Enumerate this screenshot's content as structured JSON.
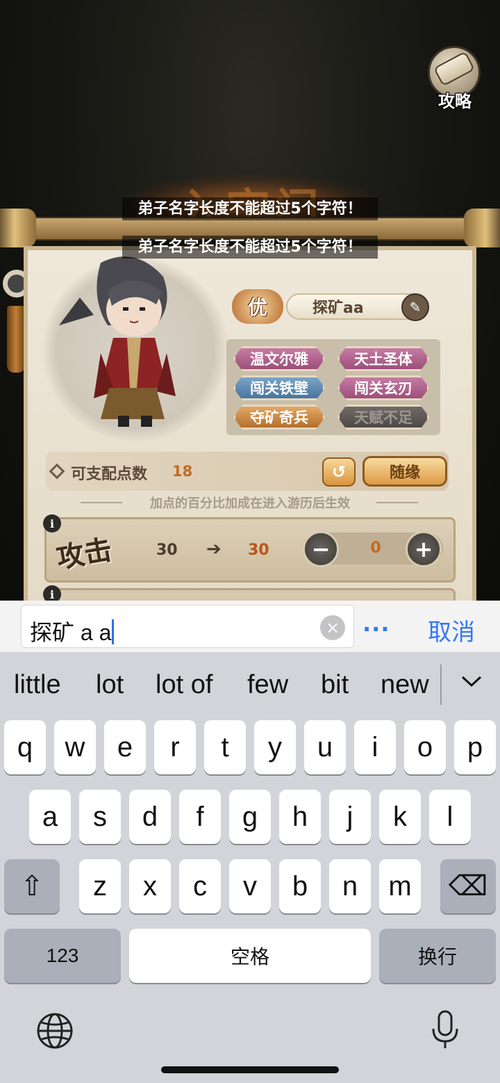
{
  "game": {
    "guide_label": "攻略",
    "title_text": "入宗门",
    "toast_messages": [
      "弟子名字长度不能超过5个字符！",
      "弟子名字长度不能超过5个字符！"
    ],
    "grade": "优",
    "disciple_name": "探矿aa",
    "traits": [
      {
        "label": "温文尔雅",
        "color": "pink"
      },
      {
        "label": "天土圣体",
        "color": "pink"
      },
      {
        "label": "闯关铁壁",
        "color": "blue"
      },
      {
        "label": "闯关玄刃",
        "color": "pink"
      },
      {
        "label": "夺矿奇兵",
        "color": "orange"
      },
      {
        "label": "天赋不足",
        "color": "grey"
      }
    ],
    "points_label": "可支配点数",
    "points_value": "18",
    "undo_icon": "↺",
    "luck_button": "随缘",
    "hint": "加点的百分比加成在进入游历后生效",
    "stat": {
      "name": "攻击",
      "base": "30",
      "arrow": "➔",
      "new": "30",
      "minus": "−",
      "plus": "+",
      "allocated": "0"
    },
    "info_icon": "i"
  },
  "input_bar": {
    "field_value": "探矿 a a",
    "clear_icon": "×",
    "more": "...",
    "cancel": "取消"
  },
  "keyboard": {
    "suggestions": [
      "little",
      "lot",
      "lot of",
      "few",
      "bit",
      "new"
    ],
    "row1": [
      "q",
      "w",
      "e",
      "r",
      "t",
      "y",
      "u",
      "i",
      "o",
      "p"
    ],
    "row2": [
      "a",
      "s",
      "d",
      "f",
      "g",
      "h",
      "j",
      "k",
      "l"
    ],
    "row3": [
      "z",
      "x",
      "c",
      "v",
      "b",
      "n",
      "m"
    ],
    "shift_icon": "⇧",
    "delete_icon": "⌫",
    "numbers_key": "123",
    "space_key": "空格",
    "return_key": "换行"
  }
}
